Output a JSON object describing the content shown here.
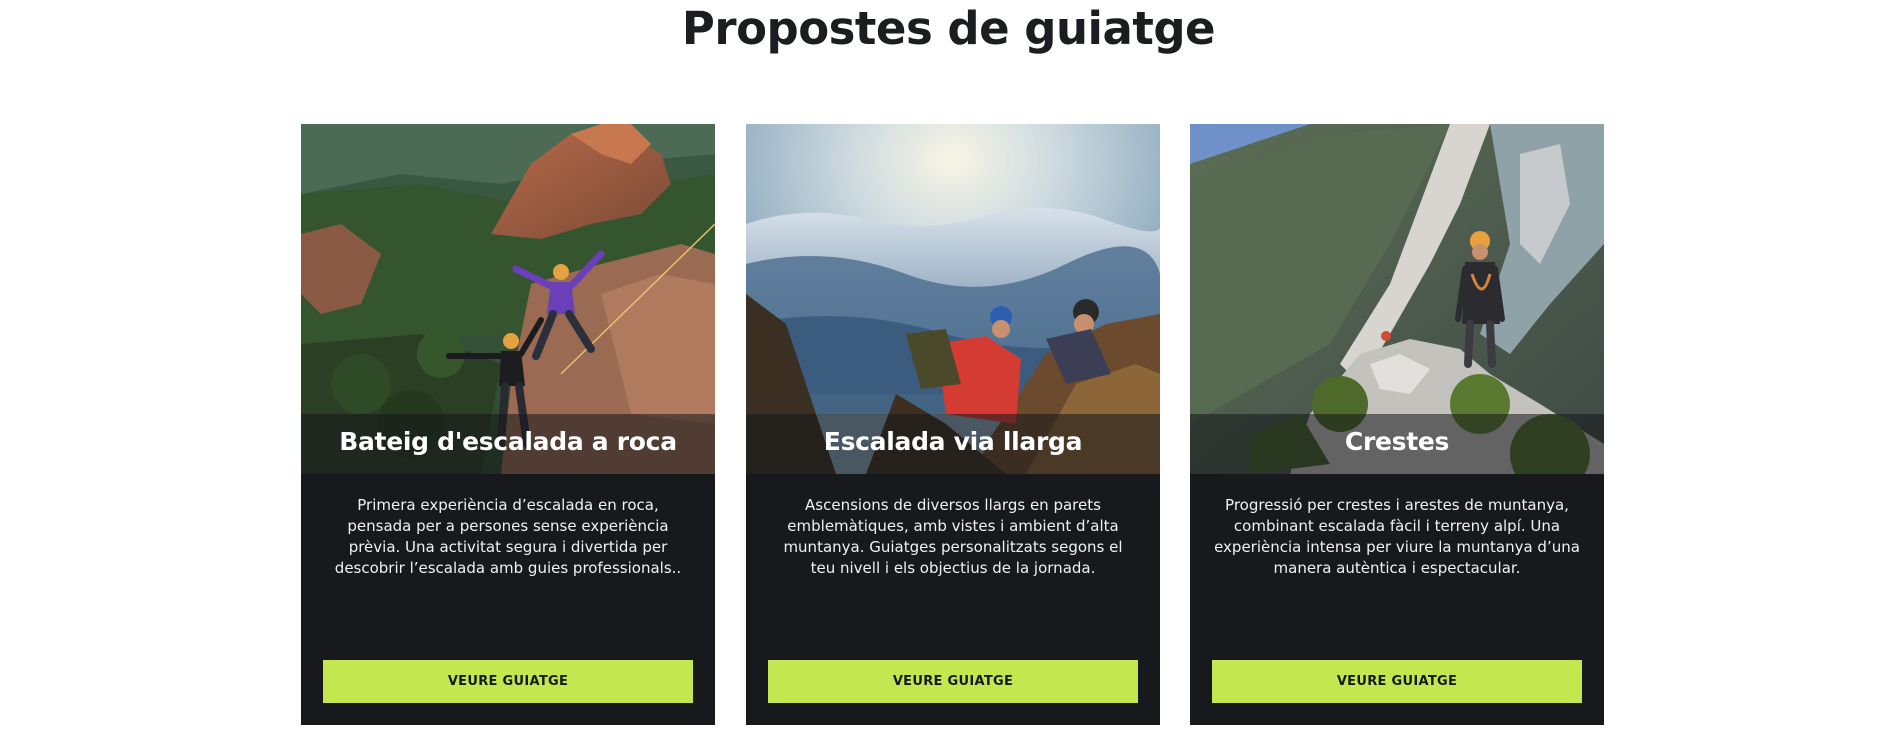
{
  "section": {
    "title": "Propostes de guiatge"
  },
  "cards": [
    {
      "title": "Bateig d'escalada a roca",
      "description": "Primera experiència d’escalada en roca, pensada per a persones sense experiència prèvia. Una activitat segura i divertida per descobrir l’escalada amb guies professionals..",
      "button_label": "VEURE GUIATGE",
      "image": "rock-climbing-photo"
    },
    {
      "title": "Escalada via llarga",
      "description": "Ascensions de diversos llargs en parets emblemàtiques, amb vistes i ambient d’alta muntanya. Guiatges personalitzats segons el teu nivell i els objectius de la jornada.",
      "button_label": "VEURE GUIATGE",
      "image": "multipitch-climbing-photo"
    },
    {
      "title": "Crestes",
      "description": "Progressió per crestes i arestes de muntanya, combinant escalada fàcil i terreny alpí. Una experiència intensa per viure la muntanya d’una manera autèntica i espectacular.",
      "button_label": "VEURE GUIATGE",
      "image": "ridge-climbing-photo"
    }
  ],
  "colors": {
    "button": "#c3e84f",
    "card_background": "#17191c",
    "title_text": "#1b1d20"
  }
}
